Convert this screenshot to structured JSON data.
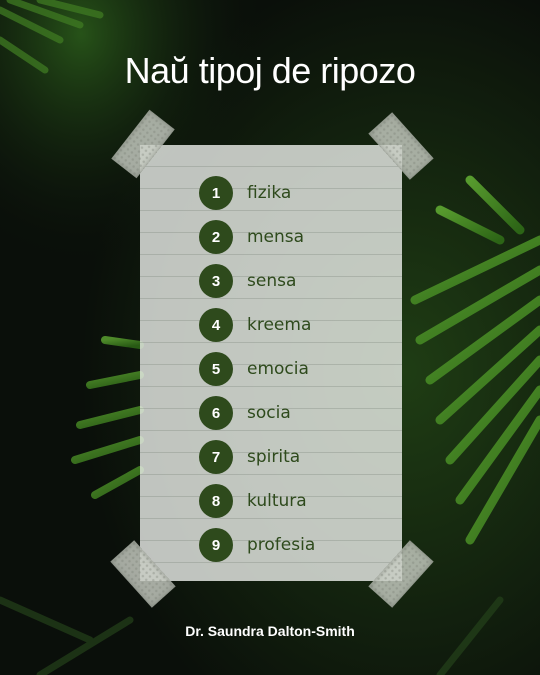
{
  "title": "Naŭ tipoj de ripozo",
  "items": [
    {
      "number": "1",
      "label": "fizika"
    },
    {
      "number": "2",
      "label": "mensa"
    },
    {
      "number": "3",
      "label": "sensa"
    },
    {
      "number": "4",
      "label": "kreema"
    },
    {
      "number": "5",
      "label": "emocia"
    },
    {
      "number": "6",
      "label": "socia"
    },
    {
      "number": "7",
      "label": "spirita"
    },
    {
      "number": "8",
      "label": "kultura"
    },
    {
      "number": "9",
      "label": "profesia"
    }
  ],
  "author": "Dr. Saundra Dalton-Smith",
  "colors": {
    "badge": "#2e4a1c",
    "label_text": "#2e4a1c",
    "card": "#eef0ec",
    "background": "#0c120c"
  }
}
